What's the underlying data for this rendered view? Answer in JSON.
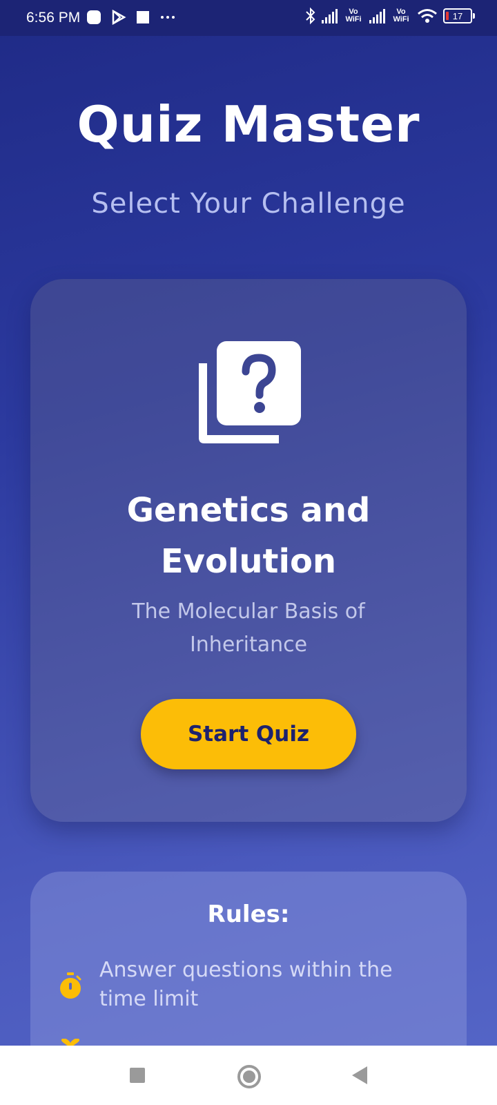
{
  "status_bar": {
    "time": "6:56 PM",
    "vowifi_1": "Vo WiFi",
    "vowifi_2": "Vo WiFi",
    "battery": "17"
  },
  "header": {
    "title": "Quiz Master",
    "subtitle": "Select Your Challenge"
  },
  "quiz_card": {
    "icon": "quiz-icon",
    "title": "Genetics and Evolution",
    "description": "The Molecular Basis of Inheritance",
    "start_label": "Start Quiz"
  },
  "rules": {
    "title": "Rules:",
    "items": [
      {
        "icon": "timer-icon",
        "text": "Answer questions within the time limit"
      }
    ]
  },
  "colors": {
    "accent": "#fcbd07",
    "background_top": "#1f2a86",
    "background_bottom": "#5667c8"
  }
}
